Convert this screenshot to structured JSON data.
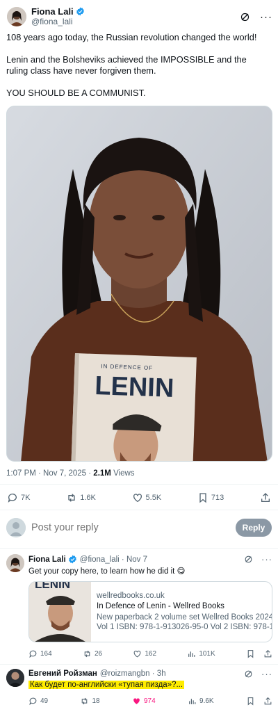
{
  "post": {
    "author_name": "Fiona Lali",
    "author_handle": "@fiona_lali",
    "text": [
      "108 years ago today, the Russian revolution changed the world!",
      "Lenin and the Bolsheviks achieved the IMPOSSIBLE and the ruling class have never forgiven them.",
      "YOU SHOULD BE A COMMUNIST."
    ],
    "book_header": "IN DEFENCE OF",
    "book_title": "LENIN",
    "timestamp": "1:07 PM · Nov 7, 2025 · ",
    "views_count": "2.1M",
    "views_label": " Views",
    "stats": {
      "replies": "7K",
      "reposts": "1.6K",
      "likes": "5.5K",
      "bookmarks": "713"
    }
  },
  "reply_box": {
    "placeholder": "Post your reply",
    "button": "Reply"
  },
  "replies": [
    {
      "name": "Fiona Lali",
      "handle": "@fiona_lali · Nov 7",
      "text": "Get your copy here, to learn how he did it 😋",
      "card": {
        "image_text": "LENIN",
        "domain": "wellredbooks.co.uk",
        "title": "In Defence of Lenin - Wellred Books",
        "desc_line1": "New paperback 2 volume set Wellred Books 2024",
        "desc_line2": "Vol 1 ISBN: 978-1-913026-95-0 Vol 2 ISBN: 978-1-..."
      },
      "stats": {
        "replies": "164",
        "reposts": "26",
        "likes": "162",
        "views": "101K"
      }
    },
    {
      "name": "Евгений Ройзман",
      "handle": "@roizmangbn · 3h",
      "text": "Как будет по-английски «тупая пизда»?...",
      "stats": {
        "replies": "49",
        "reposts": "18",
        "likes": "974",
        "views": "9.6K"
      }
    }
  ],
  "colors": {
    "accent": "#1d9bf0",
    "muted": "#536471",
    "like": "#f91880",
    "highlight": "#ffec00"
  }
}
